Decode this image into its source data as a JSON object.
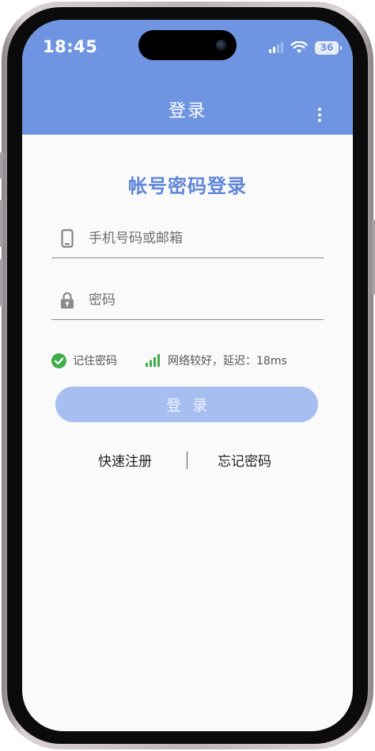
{
  "status_bar": {
    "time": "18:45",
    "battery": "36",
    "icons": [
      "cellular-signal-icon",
      "wifi-icon",
      "battery-icon"
    ]
  },
  "nav": {
    "title": "登录",
    "more_icon": "more-vertical-icon"
  },
  "form": {
    "title": "帐号密码登录",
    "account_placeholder": "手机号码或邮箱",
    "account_value": "",
    "account_icon": "phone-icon",
    "password_placeholder": "密码",
    "password_value": "",
    "password_icon": "lock-icon",
    "remember_label": "记住密码",
    "remember_checked": true,
    "network_status": "网络较好，延迟：18ms",
    "login_label": "登录",
    "register_link": "快速注册",
    "forgot_link": "忘记密码"
  },
  "colors": {
    "header": "#6f95e2",
    "accent": "#5f86d8",
    "button_disabled": "#a7bff0",
    "success": "#3fae4a"
  }
}
